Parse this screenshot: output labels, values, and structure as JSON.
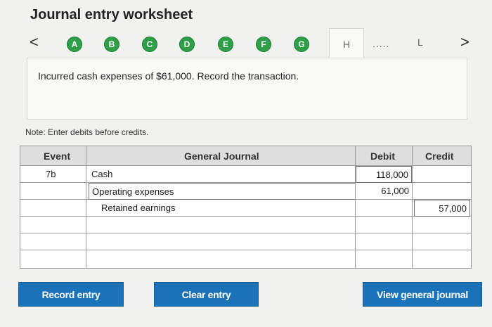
{
  "title": "Journal entry worksheet",
  "nav": {
    "prev": "<",
    "next": ">"
  },
  "steps": [
    "A",
    "B",
    "C",
    "D",
    "E",
    "F",
    "G"
  ],
  "tabs": {
    "active": "H",
    "dots": ".....",
    "last": "L"
  },
  "prompt": "Incurred cash expenses of $61,000. Record the transaction.",
  "note": "Note: Enter debits before credits.",
  "table": {
    "headers": {
      "event": "Event",
      "journal": "General Journal",
      "debit": "Debit",
      "credit": "Credit"
    },
    "rows": [
      {
        "event": "7b",
        "account": "Cash",
        "debit": "118,000",
        "credit": ""
      },
      {
        "event": "",
        "account": "Operating expenses",
        "debit": "61,000",
        "credit": ""
      },
      {
        "event": "",
        "account": "Retained earnings",
        "debit": "",
        "credit": "57,000"
      },
      {
        "event": "",
        "account": "",
        "debit": "",
        "credit": ""
      },
      {
        "event": "",
        "account": "",
        "debit": "",
        "credit": ""
      },
      {
        "event": "",
        "account": "",
        "debit": "",
        "credit": ""
      }
    ]
  },
  "buttons": {
    "record": "Record entry",
    "clear": "Clear entry",
    "view": "View general journal"
  },
  "colors": {
    "step_green": "#2e9e48",
    "button_blue": "#1a73b8",
    "header_gray": "#dedede"
  }
}
